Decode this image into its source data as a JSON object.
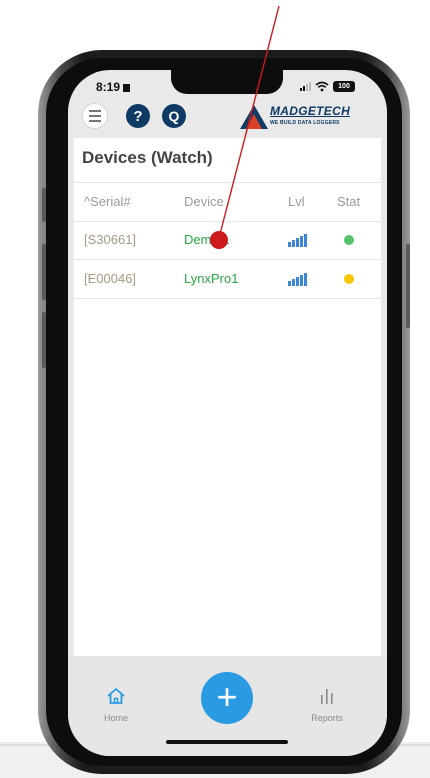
{
  "status_bar": {
    "time": "8:19",
    "battery": "100"
  },
  "header": {
    "help_icon_glyph": "?",
    "q_icon_glyph": "Q",
    "brand_name": "MADGETECH",
    "brand_tagline": "WE BUILD DATA LOGGERS"
  },
  "devices": {
    "title": "Devices (Watch)",
    "columns": {
      "serial": "^Serial#",
      "device": "Device",
      "level": "Lvl",
      "status": "Stat"
    },
    "rows": [
      {
        "serial": "[S30661]",
        "device": "Demo 1",
        "status_color": "#57c26a"
      },
      {
        "serial": "[E00046]",
        "device": "LynxPro1",
        "status_color": "#f7c600"
      }
    ]
  },
  "nav": {
    "home_label": "Home",
    "add_glyph": "+",
    "reports_label": "Reports"
  },
  "colors": {
    "accent_blue": "#2a9be3",
    "brand_navy": "#0e3a63",
    "brand_red": "#d9412b",
    "annotation": "#cc1a1f"
  }
}
